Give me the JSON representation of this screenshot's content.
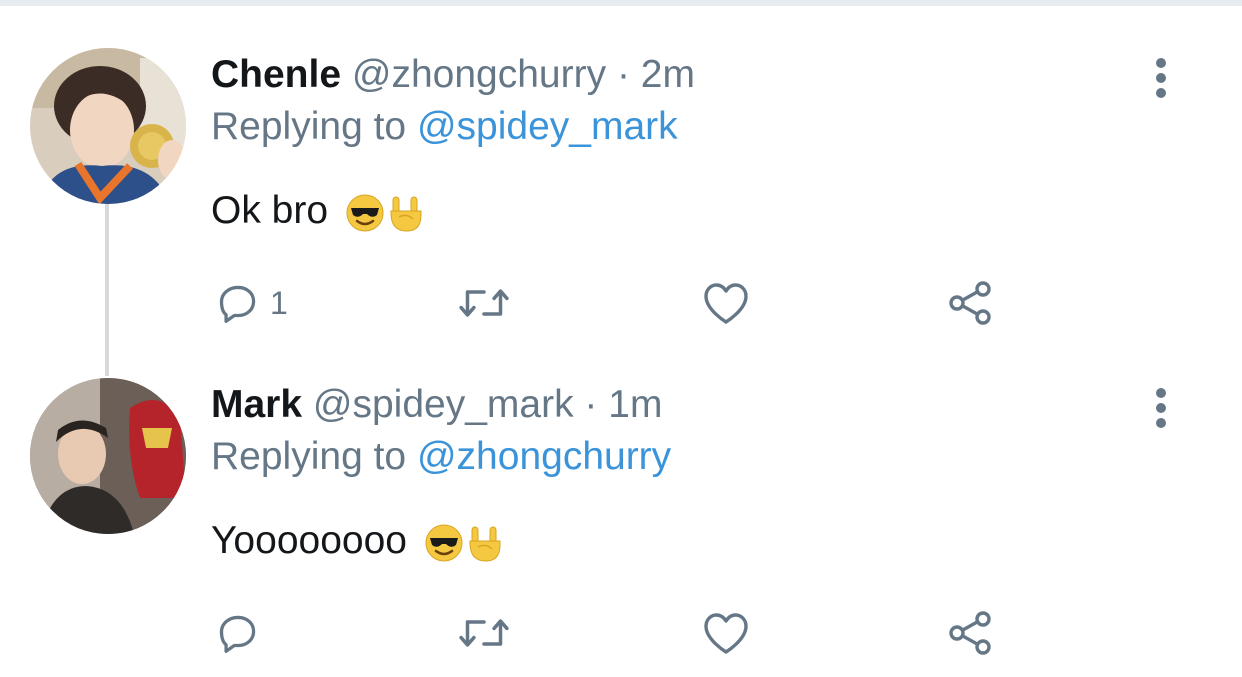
{
  "tweets": [
    {
      "name": "Chenle",
      "handle": "@zhongchurry",
      "separator": "·",
      "time": "2m",
      "replying_prefix": "Replying to",
      "replying_to": "@spidey_mark",
      "text": "Ok bro",
      "emojis": [
        "smiling-face-with-sunglasses",
        "sign-of-the-horns"
      ],
      "reply_count": "1",
      "icons": [
        "reply-icon",
        "retweet-icon",
        "like-icon",
        "share-icon",
        "more-icon"
      ]
    },
    {
      "name": "Mark",
      "handle": "@spidey_mark",
      "separator": "·",
      "time": "1m",
      "replying_prefix": "Replying to",
      "replying_to": "@zhongchurry",
      "text": "Yoooooooo",
      "emojis": [
        "smiling-face-with-sunglasses",
        "sign-of-the-horns"
      ],
      "reply_count": "",
      "icons": [
        "reply-icon",
        "retweet-icon",
        "like-icon",
        "share-icon",
        "more-icon"
      ]
    }
  ],
  "colors": {
    "text": "#14171a",
    "secondary": "#657786",
    "link": "#3b94d9",
    "thread_line": "#d8d8d8",
    "divider": "#e6ecf0"
  }
}
